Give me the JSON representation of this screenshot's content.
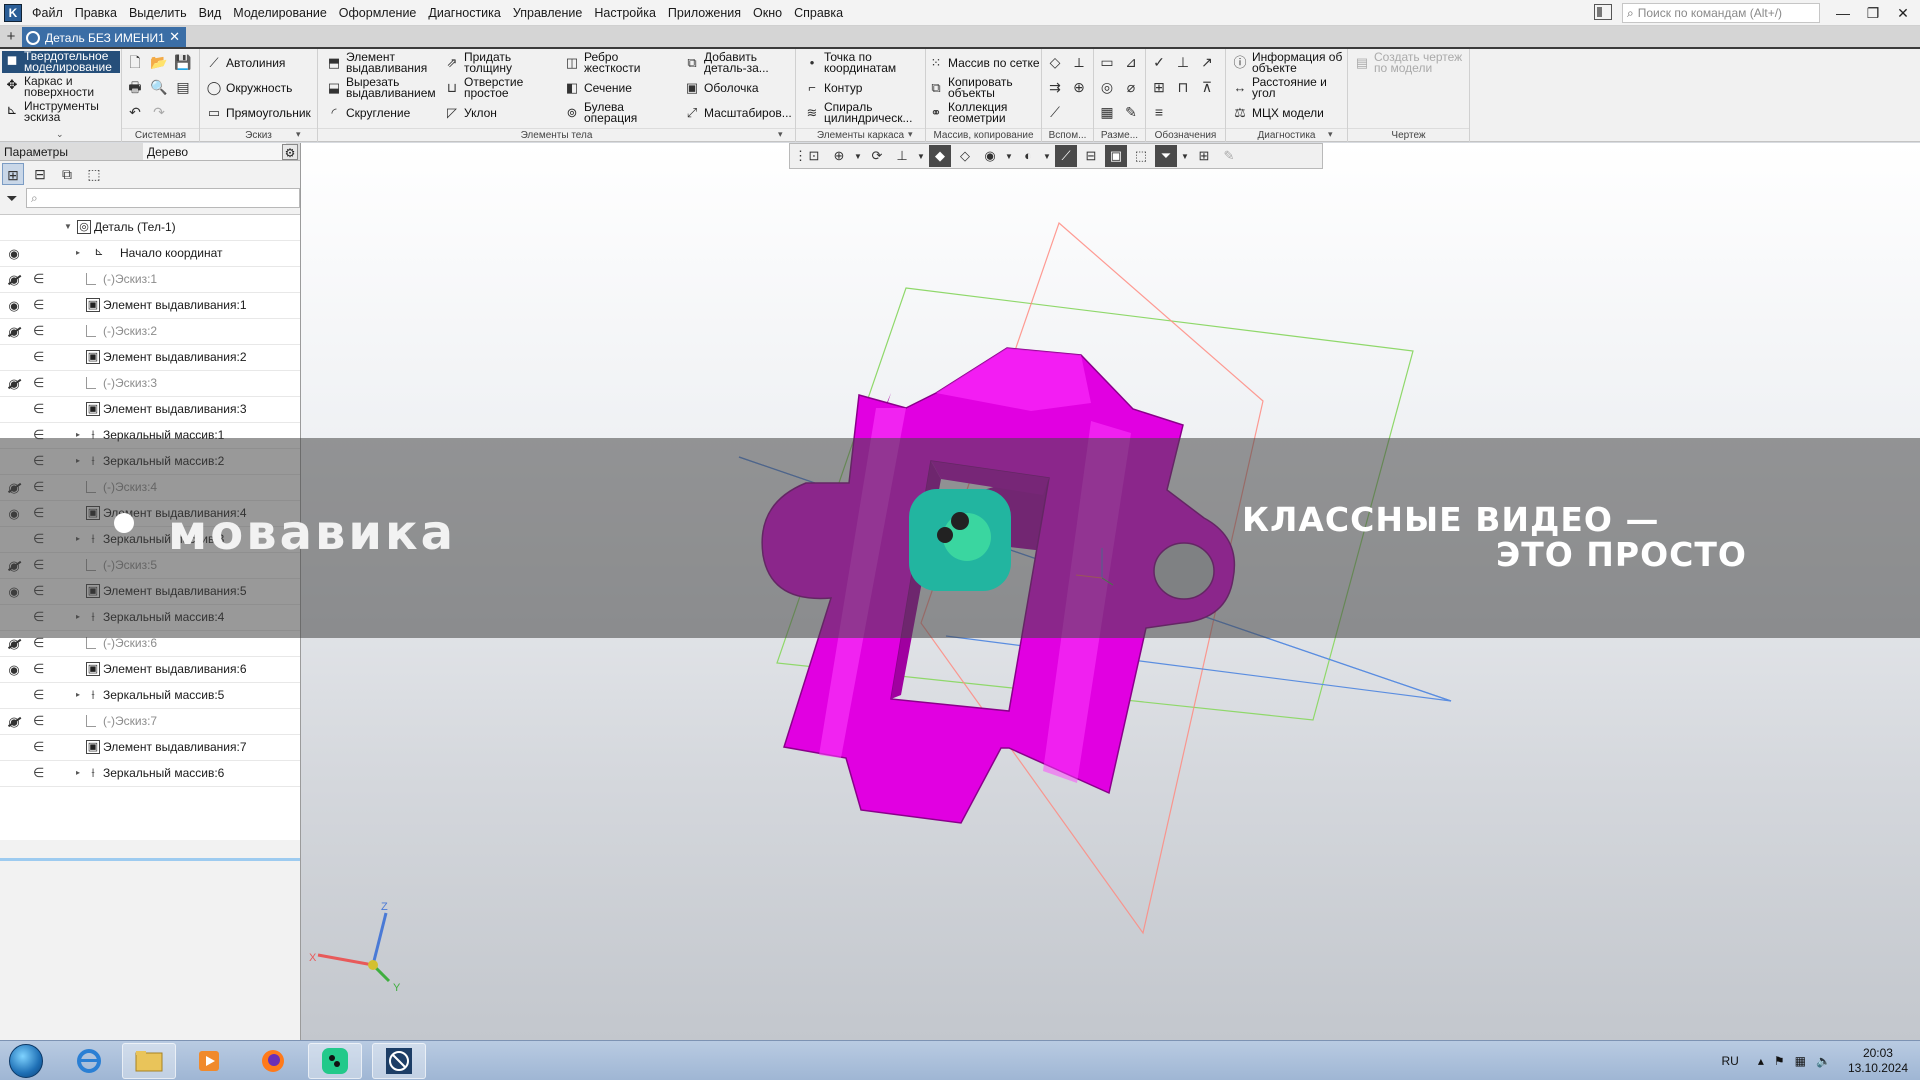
{
  "menu": {
    "items": [
      "Файл",
      "Правка",
      "Выделить",
      "Вид",
      "Моделирование",
      "Оформление",
      "Диагностика",
      "Управление",
      "Настройка",
      "Приложения",
      "Окно",
      "Справка"
    ],
    "search_placeholder": "Поиск по командам (Alt+/)"
  },
  "window_controls": {
    "minimize": "—",
    "restore": "❐",
    "close": "✕"
  },
  "document_tab": {
    "title": "Деталь БЕЗ ИМЕНИ1",
    "close": "✕"
  },
  "ribbon": {
    "modes": [
      "Твердотельное\nмоделирование",
      "Каркас и\nповерхности",
      "Инструменты\nэскиза"
    ],
    "group_labels": {
      "system": "Системная",
      "sketch": "Эскиз",
      "body": "Элементы тела",
      "frame": "Элементы каркаса",
      "array": "Массив, копирование",
      "aux": "Вспом...",
      "dims": "Разме...",
      "marks": "Обозначения",
      "diagnostics": "Диагностика",
      "drawing": "Чертеж"
    },
    "sketch_buttons": [
      "Автолиния",
      "Окружность",
      "Прямоугольник"
    ],
    "body_buttons": [
      "Элемент\nвыдавливания",
      "Вырезать\nвыдавливанием",
      "Скругление",
      "Придать\nтолщину",
      "Отверстие\nпростое",
      "Уклон",
      "Ребро\nжесткости",
      "Сечение",
      "Булева\nоперация",
      "Добавить\nдеталь-за...",
      "Оболочка",
      "Масштабиров..."
    ],
    "frame_buttons": [
      "Точка по\nкоординатам",
      "Контур",
      "Спираль\nцилиндрическ..."
    ],
    "array_buttons": [
      "Массив по сетке",
      "Копировать\nобъекты",
      "Коллекция\nгеометрии"
    ],
    "diag_buttons": [
      "Информация об\nобъекте",
      "Расстояние и\nугол",
      "МЦХ модели"
    ],
    "drawing_buttons": [
      "Создать чертеж\nпо модели"
    ]
  },
  "panel": {
    "tabs": [
      "Параметры",
      "Дерево"
    ],
    "settings_icon": "⚙"
  },
  "tree": {
    "search_icon": "⌕",
    "root": "Деталь (Тел-1)",
    "rows": [
      {
        "label": "Начало координат",
        "type": "origin",
        "eye": "on",
        "expand": true,
        "dim": false
      },
      {
        "label": "(-)Эскиз:1",
        "type": "sketch",
        "eye": "off",
        "expand": false,
        "dim": true
      },
      {
        "label": "Элемент выдавливания:1",
        "type": "extrude",
        "eye": "on",
        "expand": false,
        "dim": false
      },
      {
        "label": "(-)Эскиз:2",
        "type": "sketch",
        "eye": "off",
        "expand": false,
        "dim": true
      },
      {
        "label": "Элемент выдавливания:2",
        "type": "extrude",
        "eye": "none",
        "expand": false,
        "dim": false
      },
      {
        "label": "(-)Эскиз:3",
        "type": "sketch",
        "eye": "off",
        "expand": false,
        "dim": true
      },
      {
        "label": "Элемент выдавливания:3",
        "type": "extrude",
        "eye": "none",
        "expand": false,
        "dim": false
      },
      {
        "label": "Зеркальный массив:1",
        "type": "mirror",
        "eye": "none",
        "expand": true,
        "dim": false
      },
      {
        "label": "Зеркальный массив:2",
        "type": "mirror",
        "eye": "none",
        "expand": true,
        "dim": false
      },
      {
        "label": "(-)Эскиз:4",
        "type": "sketch",
        "eye": "off",
        "expand": false,
        "dim": true
      },
      {
        "label": "Элемент выдавливания:4",
        "type": "extrude",
        "eye": "on",
        "expand": false,
        "dim": false
      },
      {
        "label": "Зеркальный массив:3",
        "type": "mirror",
        "eye": "none",
        "expand": true,
        "dim": false
      },
      {
        "label": "(-)Эскиз:5",
        "type": "sketch",
        "eye": "off",
        "expand": false,
        "dim": true
      },
      {
        "label": "Элемент выдавливания:5",
        "type": "extrude",
        "eye": "on",
        "expand": false,
        "dim": false
      },
      {
        "label": "Зеркальный массив:4",
        "type": "mirror",
        "eye": "none",
        "expand": true,
        "dim": false
      },
      {
        "label": "(-)Эскиз:6",
        "type": "sketch",
        "eye": "off",
        "expand": false,
        "dim": true
      },
      {
        "label": "Элемент выдавливания:6",
        "type": "extrude",
        "eye": "on",
        "expand": false,
        "dim": false
      },
      {
        "label": "Зеркальный массив:5",
        "type": "mirror",
        "eye": "none",
        "expand": true,
        "dim": false
      },
      {
        "label": "(-)Эскиз:7",
        "type": "sketch",
        "eye": "off",
        "expand": false,
        "dim": true
      },
      {
        "label": "Элемент выдавливания:7",
        "type": "extrude",
        "eye": "none",
        "expand": false,
        "dim": false
      },
      {
        "label": "Зеркальный массив:6",
        "type": "mirror",
        "eye": "none",
        "expand": true,
        "dim": false
      }
    ]
  },
  "viewport": {
    "model_color": "#e100e1",
    "axis_labels": {
      "x": "X",
      "y": "Y",
      "z": "Z"
    }
  },
  "watermark": {
    "brand": "мовавика",
    "tagline_1": "КЛАССНЫЕ ВИДЕО —",
    "tagline_2": "ЭТО ПРОСТО"
  },
  "taskbar": {
    "language": "RU",
    "time": "20:03",
    "date": "13.10.2024"
  }
}
